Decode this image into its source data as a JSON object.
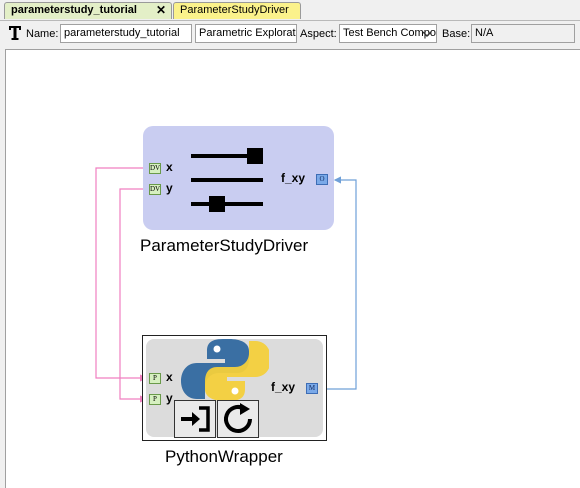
{
  "tabs": [
    {
      "label": "parameterstudy_tutorial",
      "close": "✕"
    },
    {
      "label": "ParameterStudyDriver"
    }
  ],
  "toolbar": {
    "name_label": "Name:",
    "name_value": "parameterstudy_tutorial",
    "kind_value": "Parametric Exploration",
    "aspect_label": "Aspect:",
    "aspect_value": "Test Bench Composition",
    "base_label": "Base:",
    "base_value": "N/A"
  },
  "driver": {
    "name": "ParameterStudyDriver",
    "inputs": [
      {
        "tag": "DV",
        "label": "x"
      },
      {
        "tag": "DV",
        "label": "y"
      }
    ],
    "output": {
      "tag": "O",
      "label": "f_xy"
    }
  },
  "wrapper": {
    "name": "PythonWrapper",
    "inputs": [
      {
        "tag": "P",
        "label": "x"
      },
      {
        "tag": "P",
        "label": "y"
      }
    ],
    "output": {
      "tag": "M",
      "label": "f_xy"
    }
  },
  "colors": {
    "driver_fill": "#c9cdf1",
    "wire_input": "#f07fc0",
    "wire_output": "#6fa0d8",
    "tab_active": "#e3efc7",
    "tab_other": "#fbf28b"
  }
}
